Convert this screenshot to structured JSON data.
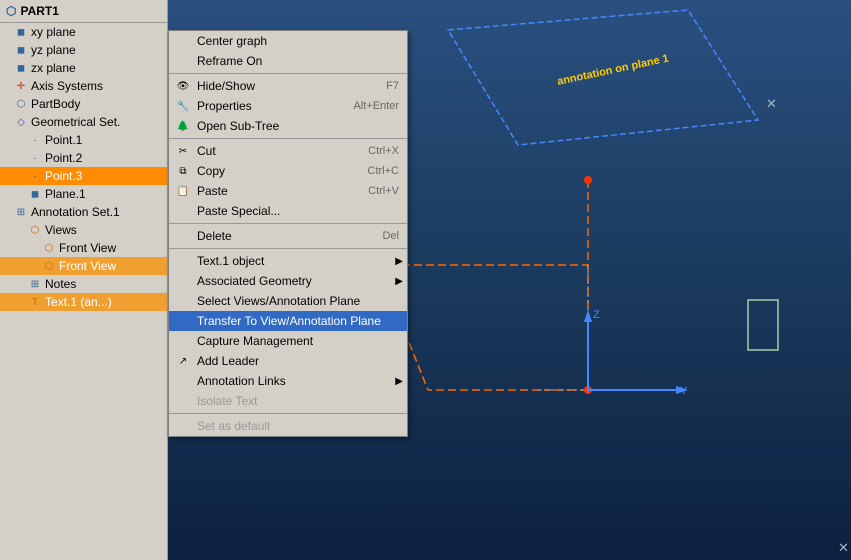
{
  "app": {
    "title": "PART1"
  },
  "tree": {
    "root": "PART1",
    "items": [
      {
        "id": "xy-plane",
        "label": "xy plane",
        "indent": 1,
        "icon": "plane"
      },
      {
        "id": "yz-plane",
        "label": "yz plane",
        "indent": 1,
        "icon": "plane"
      },
      {
        "id": "zx-plane",
        "label": "zx plane",
        "indent": 1,
        "icon": "plane"
      },
      {
        "id": "axis-systems",
        "label": "Axis Systems",
        "indent": 1,
        "icon": "axis"
      },
      {
        "id": "part-body",
        "label": "PartBody",
        "indent": 1,
        "icon": "part"
      },
      {
        "id": "geometrical-set",
        "label": "Geometrical Set.",
        "indent": 1,
        "icon": "geo"
      },
      {
        "id": "point1",
        "label": "Point.1",
        "indent": 2,
        "icon": "point"
      },
      {
        "id": "point2",
        "label": "Point.2",
        "indent": 2,
        "icon": "point"
      },
      {
        "id": "point3",
        "label": "Point.3",
        "indent": 2,
        "icon": "point",
        "selected": true
      },
      {
        "id": "plane1",
        "label": "Plane.1",
        "indent": 2,
        "icon": "plane"
      },
      {
        "id": "annotation-set",
        "label": "Annotation Set.1",
        "indent": 1,
        "icon": "annot"
      },
      {
        "id": "views",
        "label": "Views",
        "indent": 2,
        "icon": "views"
      },
      {
        "id": "front-view1",
        "label": "Front View",
        "indent": 3,
        "icon": "views"
      },
      {
        "id": "front-view2",
        "label": "Front View",
        "indent": 3,
        "icon": "views",
        "highlighted": true
      },
      {
        "id": "notes",
        "label": "Notes",
        "indent": 2,
        "icon": "notes"
      },
      {
        "id": "text1",
        "label": "Text.1 (an...)",
        "indent": 2,
        "icon": "text",
        "highlighted": true
      }
    ]
  },
  "context_menu": {
    "items": [
      {
        "id": "center-graph",
        "label": "Center graph",
        "shortcut": "",
        "has_icon": false,
        "has_submenu": false,
        "disabled": false
      },
      {
        "id": "reframe-on",
        "label": "Reframe On",
        "shortcut": "",
        "has_icon": false,
        "has_submenu": false,
        "disabled": false
      },
      {
        "id": "separator1",
        "type": "separator"
      },
      {
        "id": "hide-show",
        "label": "Hide/Show",
        "shortcut": "F7",
        "has_icon": true,
        "icon": "eye",
        "has_submenu": false,
        "disabled": false
      },
      {
        "id": "properties",
        "label": "Properties",
        "shortcut": "Alt+Enter",
        "has_icon": true,
        "icon": "props",
        "has_submenu": false,
        "disabled": false
      },
      {
        "id": "open-sub-tree",
        "label": "Open Sub-Tree",
        "shortcut": "",
        "has_icon": true,
        "icon": "tree",
        "has_submenu": false,
        "disabled": false
      },
      {
        "id": "separator2",
        "type": "separator"
      },
      {
        "id": "cut",
        "label": "Cut",
        "shortcut": "Ctrl+X",
        "has_icon": true,
        "icon": "cut",
        "has_submenu": false,
        "disabled": false
      },
      {
        "id": "copy",
        "label": "Copy",
        "shortcut": "Ctrl+C",
        "has_icon": true,
        "icon": "copy",
        "has_submenu": false,
        "disabled": false
      },
      {
        "id": "paste",
        "label": "Paste",
        "shortcut": "Ctrl+V",
        "has_icon": true,
        "icon": "paste",
        "has_submenu": false,
        "disabled": false
      },
      {
        "id": "paste-special",
        "label": "Paste Special...",
        "shortcut": "",
        "has_icon": false,
        "has_submenu": false,
        "disabled": false
      },
      {
        "id": "separator3",
        "type": "separator"
      },
      {
        "id": "delete",
        "label": "Delete",
        "shortcut": "Del",
        "has_icon": false,
        "has_submenu": false,
        "disabled": false
      },
      {
        "id": "separator4",
        "type": "separator"
      },
      {
        "id": "text1-object",
        "label": "Text.1 object",
        "shortcut": "",
        "has_icon": false,
        "has_submenu": true,
        "disabled": false
      },
      {
        "id": "associated-geometry",
        "label": "Associated Geometry",
        "shortcut": "",
        "has_icon": false,
        "has_submenu": true,
        "disabled": false
      },
      {
        "id": "select-views",
        "label": "Select Views/Annotation Plane",
        "shortcut": "",
        "has_icon": false,
        "has_submenu": false,
        "disabled": false
      },
      {
        "id": "transfer-to-view",
        "label": "Transfer To View/Annotation Plane",
        "shortcut": "",
        "has_icon": false,
        "has_submenu": false,
        "disabled": false,
        "active": true
      },
      {
        "id": "capture-management",
        "label": "Capture Management",
        "shortcut": "",
        "has_icon": false,
        "has_submenu": false,
        "disabled": false
      },
      {
        "id": "add-leader",
        "label": "Add Leader",
        "shortcut": "",
        "has_icon": true,
        "icon": "leader",
        "has_submenu": false,
        "disabled": false
      },
      {
        "id": "annotation-links",
        "label": "Annotation Links",
        "shortcut": "",
        "has_icon": false,
        "has_submenu": true,
        "disabled": false
      },
      {
        "id": "isolate-text",
        "label": "Isolate Text",
        "shortcut": "",
        "has_icon": false,
        "has_submenu": false,
        "disabled": true
      },
      {
        "id": "separator5",
        "type": "separator"
      },
      {
        "id": "set-as-default",
        "label": "Set as default",
        "shortcut": "",
        "has_icon": false,
        "has_submenu": false,
        "disabled": true
      }
    ]
  },
  "annotation": {
    "text": "annotation on plane 1"
  }
}
